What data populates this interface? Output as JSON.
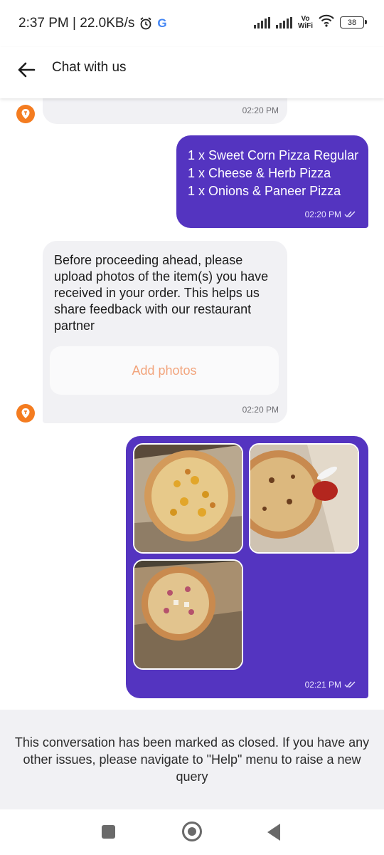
{
  "status_bar": {
    "time_speed": "2:37 PM | 22.0KB/s",
    "vowifi_line1": "Vo",
    "vowifi_line2": "WiFi",
    "battery": "38"
  },
  "header": {
    "title": "Chat with us",
    "back_icon": "arrow-left-icon"
  },
  "messages": [
    {
      "type": "incoming",
      "time": "02:20 PM"
    },
    {
      "type": "outgoing",
      "lines": [
        "1 x Sweet Corn Pizza Regular",
        "1 x Cheese & Herb Pizza",
        "1 x Onions & Paneer Pizza"
      ],
      "time": "02:20 PM",
      "status_icon": "double-check-icon"
    },
    {
      "type": "incoming",
      "text": "Before proceeding ahead, please upload photos of the item(s) you have received in your order. This helps us share feedback with our restaurant partner",
      "button_label": "Add photos",
      "time": "02:20 PM"
    },
    {
      "type": "outgoing",
      "photos": [
        "pizza-photo-1",
        "pizza-photo-2",
        "pizza-photo-3"
      ],
      "time": "02:21 PM",
      "status_icon": "double-check-icon"
    }
  ],
  "closed_notice": "This conversation has been marked as closed. If you have any other issues, please navigate to \"Help\" menu to raise a new query",
  "colors": {
    "brand_orange": "#f47c20",
    "outgoing_bubble": "#5434c0",
    "incoming_bubble": "#f1f1f4",
    "add_photos_text": "#f2a47c"
  }
}
